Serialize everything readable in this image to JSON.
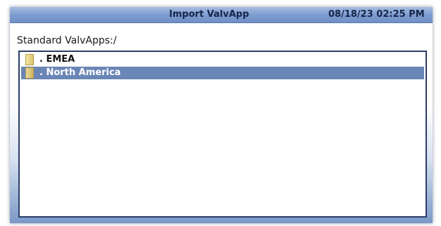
{
  "header": {
    "title": "Import ValvApp",
    "datetime": "08/18/23 02:25 PM"
  },
  "path_label": "Standard ValvApps:/",
  "list": {
    "items": [
      {
        "label": ". EMEA",
        "icon": "folder-icon",
        "selected": false
      },
      {
        "label": ". North America",
        "icon": "folder-icon",
        "selected": true
      }
    ]
  },
  "colors": {
    "titlebar": "#7e9cd0",
    "selection": "#6a86b6",
    "folder": "#e2cd78"
  }
}
